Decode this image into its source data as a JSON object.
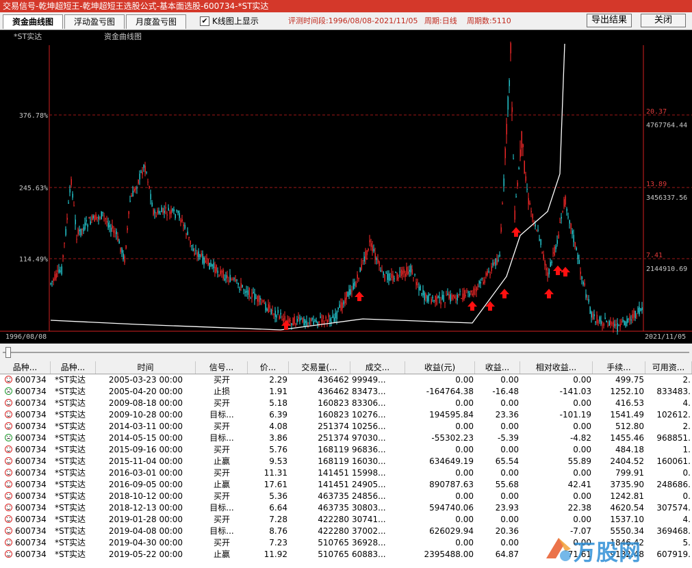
{
  "window": {
    "title": "交易信号-乾坤超短王-乾坤超短王选股公式-基本面选股-600734-*ST实达"
  },
  "toolbar": {
    "tabs": [
      {
        "label": "资金曲线图",
        "active": true
      },
      {
        "label": "浮动盈亏图",
        "active": false
      },
      {
        "label": "月度盈亏图",
        "active": false
      }
    ],
    "checkbox_label": "K线图上显示",
    "checkbox_checked": true,
    "checkbox_mark": "✔",
    "period_text": "评测时间段:1996/08/08-2021/11/05",
    "cycle_text": "周期:日线",
    "count_text": "周期数:5110",
    "export_label": "导出结果",
    "close_label": "关闭"
  },
  "chart_data": {
    "type": "line",
    "stock_name": "*ST实达",
    "title": "资金曲线图",
    "x_start": "1996/08/08",
    "x_end": "2021/11/05",
    "left_axis": {
      "ticks": [
        "376.78%",
        "245.63%",
        "114.49%"
      ]
    },
    "right_price_axis": {
      "ticks": [
        "20.37",
        "13.89",
        "7.41"
      ]
    },
    "right_capital_axis": {
      "ticks": [
        "4767764.44",
        "3456337.56",
        "2144910.69"
      ]
    },
    "buy_marker_count": 9,
    "colors": {
      "background": "#000000",
      "frame": "#d42020",
      "grid": "#a01818",
      "up_candle": "#ff2a2a",
      "down_candle": "#27d8e0",
      "capital_line": "#ffffff",
      "marker": "#ff1010",
      "axis_text": "#c8c8c8",
      "right_price_text": "#e03a3a"
    }
  },
  "table": {
    "headers": [
      "品种...",
      "品种...",
      "时间",
      "信号...",
      "价...",
      "交易量(...",
      "成交...",
      "收益(元)",
      "收益...",
      "相对收益...",
      "手续...",
      "可用资..."
    ],
    "rows": [
      {
        "face": "up",
        "code": "600734",
        "name": "*ST实达",
        "time": "2005-03-23  00:00",
        "signal": "买开",
        "price": "2.29",
        "volume": "436462",
        "amount": "99949...",
        "profit": "0.00",
        "pct": "0.00",
        "rel": "0.00",
        "fee": "499.75",
        "avail": "2."
      },
      {
        "face": "down",
        "code": "600734",
        "name": "*ST实达",
        "time": "2005-04-20  00:00",
        "signal": "止损",
        "price": "1.91",
        "volume": "436462",
        "amount": "83473...",
        "profit": "-164764.38",
        "pct": "-16.48",
        "rel": "-141.03",
        "fee": "1252.10",
        "avail": "833483."
      },
      {
        "face": "up",
        "code": "600734",
        "name": "*ST实达",
        "time": "2009-08-18  00:00",
        "signal": "买开",
        "price": "5.18",
        "volume": "160823",
        "amount": "83306...",
        "profit": "0.00",
        "pct": "0.00",
        "rel": "0.00",
        "fee": "416.53",
        "avail": "4."
      },
      {
        "face": "up",
        "code": "600734",
        "name": "*ST实达",
        "time": "2009-10-28  00:00",
        "signal": "目标...",
        "price": "6.39",
        "volume": "160823",
        "amount": "10276...",
        "profit": "194595.84",
        "pct": "23.36",
        "rel": "-101.19",
        "fee": "1541.49",
        "avail": "102612."
      },
      {
        "face": "up",
        "code": "600734",
        "name": "*ST实达",
        "time": "2014-03-11  00:00",
        "signal": "买开",
        "price": "4.08",
        "volume": "251374",
        "amount": "10256...",
        "profit": "0.00",
        "pct": "0.00",
        "rel": "0.00",
        "fee": "512.80",
        "avail": "2."
      },
      {
        "face": "down",
        "code": "600734",
        "name": "*ST实达",
        "time": "2014-05-15  00:00",
        "signal": "目标...",
        "price": "3.86",
        "volume": "251374",
        "amount": "97030...",
        "profit": "-55302.23",
        "pct": "-5.39",
        "rel": "-4.82",
        "fee": "1455.46",
        "avail": "968851."
      },
      {
        "face": "up",
        "code": "600734",
        "name": "*ST实达",
        "time": "2015-09-16  00:00",
        "signal": "买开",
        "price": "5.76",
        "volume": "168119",
        "amount": "96836...",
        "profit": "0.00",
        "pct": "0.00",
        "rel": "0.00",
        "fee": "484.18",
        "avail": "1."
      },
      {
        "face": "up",
        "code": "600734",
        "name": "*ST实达",
        "time": "2015-11-04  00:00",
        "signal": "止赢",
        "price": "9.53",
        "volume": "168119",
        "amount": "16030...",
        "profit": "634649.19",
        "pct": "65.54",
        "rel": "55.89",
        "fee": "2404.52",
        "avail": "160061."
      },
      {
        "face": "up",
        "code": "600734",
        "name": "*ST实达",
        "time": "2016-03-01  00:00",
        "signal": "买开",
        "price": "11.31",
        "volume": "141451",
        "amount": "15998...",
        "profit": "0.00",
        "pct": "0.00",
        "rel": "0.00",
        "fee": "799.91",
        "avail": "0."
      },
      {
        "face": "up",
        "code": "600734",
        "name": "*ST实达",
        "time": "2016-09-05  00:00",
        "signal": "止赢",
        "price": "17.61",
        "volume": "141451",
        "amount": "24905...",
        "profit": "890787.63",
        "pct": "55.68",
        "rel": "42.41",
        "fee": "3735.90",
        "avail": "248686."
      },
      {
        "face": "up",
        "code": "600734",
        "name": "*ST实达",
        "time": "2018-10-12  00:00",
        "signal": "买开",
        "price": "5.36",
        "volume": "463735",
        "amount": "24856...",
        "profit": "0.00",
        "pct": "0.00",
        "rel": "0.00",
        "fee": "1242.81",
        "avail": "0."
      },
      {
        "face": "up",
        "code": "600734",
        "name": "*ST实达",
        "time": "2018-12-13  00:00",
        "signal": "目标...",
        "price": "6.64",
        "volume": "463735",
        "amount": "30803...",
        "profit": "594740.06",
        "pct": "23.93",
        "rel": "22.38",
        "fee": "4620.54",
        "avail": "307574."
      },
      {
        "face": "up",
        "code": "600734",
        "name": "*ST实达",
        "time": "2019-01-28  00:00",
        "signal": "买开",
        "price": "7.28",
        "volume": "422280",
        "amount": "30741...",
        "profit": "0.00",
        "pct": "0.00",
        "rel": "0.00",
        "fee": "1537.10",
        "avail": "4."
      },
      {
        "face": "up",
        "code": "600734",
        "name": "*ST实达",
        "time": "2019-04-08  00:00",
        "signal": "目标...",
        "price": "8.76",
        "volume": "422280",
        "amount": "37002...",
        "profit": "626029.94",
        "pct": "20.36",
        "rel": "-7.07",
        "fee": "5550.34",
        "avail": "369468."
      },
      {
        "face": "up",
        "code": "600734",
        "name": "*ST实达",
        "time": "2019-04-30  00:00",
        "signal": "买开",
        "price": "7.23",
        "volume": "510765",
        "amount": "36928...",
        "profit": "0.00",
        "pct": "0.00",
        "rel": "0.00",
        "fee": "1846.42",
        "avail": "5."
      },
      {
        "face": "up",
        "code": "600734",
        "name": "*ST实达",
        "time": "2019-05-22  00:00",
        "signal": "止赢",
        "price": "11.92",
        "volume": "510765",
        "amount": "60883...",
        "profit": "2395488.00",
        "pct": "64.87",
        "rel": "71.61",
        "fee": "9132.48",
        "avail": "607919."
      }
    ]
  },
  "watermark": {
    "text": "万股网"
  }
}
